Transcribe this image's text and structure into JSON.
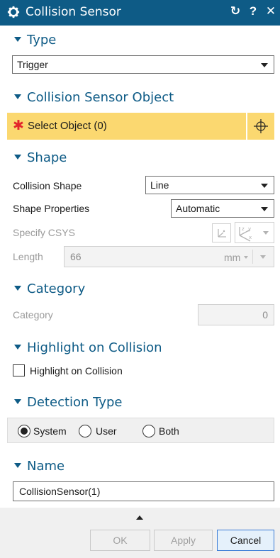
{
  "window": {
    "title": "Collision Sensor",
    "reset_glyph": "↻",
    "help_glyph": "?",
    "close_glyph": "✕"
  },
  "type_section": {
    "title": "Type",
    "value": "Trigger"
  },
  "object_section": {
    "title": "Collision Sensor Object",
    "required_mark": "✱",
    "select_label": "Select Object (0)"
  },
  "shape_section": {
    "title": "Shape",
    "collision_shape_label": "Collision Shape",
    "collision_shape_value": "Line",
    "shape_properties_label": "Shape Properties",
    "shape_properties_value": "Automatic",
    "specify_csys_label": "Specify CSYS",
    "length_label": "Length",
    "length_value": "66",
    "length_unit": "mm"
  },
  "category_section": {
    "title": "Category",
    "category_label": "Category",
    "category_value": "0"
  },
  "highlight_section": {
    "title": "Highlight on Collision",
    "checkbox_label": "Highlight on Collision",
    "checked": false
  },
  "detection_section": {
    "title": "Detection Type",
    "options": [
      "System",
      "User",
      "Both"
    ],
    "selected": "System"
  },
  "name_section": {
    "title": "Name",
    "value": "CollisionSensor(1)"
  },
  "footer": {
    "ok_label": "OK",
    "apply_label": "Apply",
    "cancel_label": "Cancel"
  },
  "colors": {
    "titlebar": "#0e5b86",
    "accent": "#0e5b86",
    "selection_bar": "#fbd870",
    "required": "#e3242b"
  }
}
